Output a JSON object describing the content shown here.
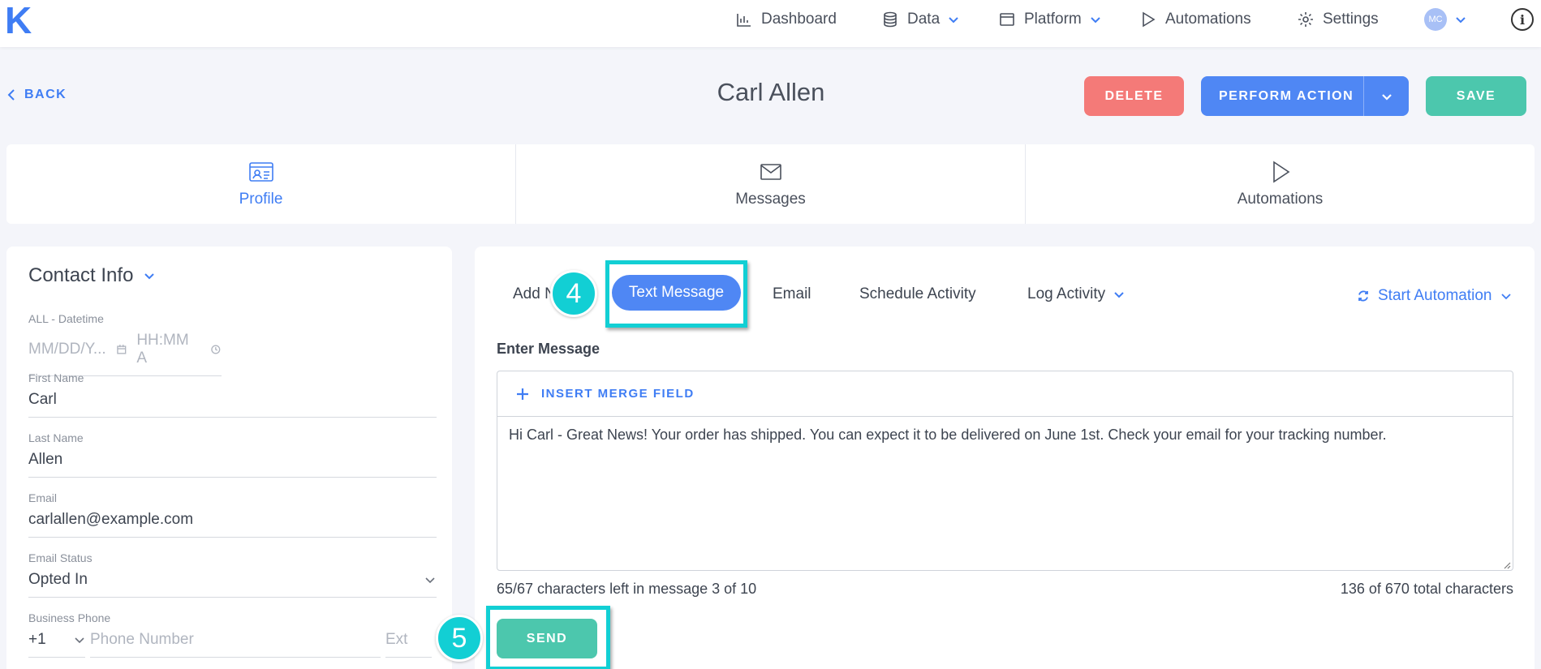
{
  "app": {
    "logo": "K"
  },
  "nav": {
    "dashboard": "Dashboard",
    "data": "Data",
    "platform": "Platform",
    "automations": "Automations",
    "settings": "Settings",
    "avatar_initials": "MC",
    "info": "i"
  },
  "header": {
    "back": "BACK",
    "title": "Carl Allen",
    "delete": "DELETE",
    "perform_action": "PERFORM ACTION",
    "save": "SAVE"
  },
  "tabs": [
    {
      "label": "Profile",
      "icon": "id-card-icon",
      "active": true
    },
    {
      "label": "Messages",
      "icon": "envelope-icon"
    },
    {
      "label": "Automations",
      "icon": "play-icon"
    }
  ],
  "contact": {
    "title": "Contact Info",
    "datetime": {
      "label": "ALL - Datetime",
      "date_placeholder": "MM/DD/Y...",
      "time_placeholder": "HH:MM A"
    },
    "first_name": {
      "label": "First Name",
      "value": "Carl"
    },
    "last_name": {
      "label": "Last Name",
      "value": "Allen"
    },
    "email": {
      "label": "Email",
      "value": "carlallen@example.com"
    },
    "email_status": {
      "label": "Email Status",
      "value": "Opted In"
    },
    "business_phone": {
      "label": "Business Phone",
      "country_code": "+1",
      "placeholder": "Phone Number",
      "ext_placeholder": "Ext"
    }
  },
  "messages": {
    "sub_tabs": {
      "add_note": "Add N",
      "text_message": "Text Message",
      "email": "Email",
      "schedule_activity": "Schedule Activity",
      "log_activity": "Log Activity"
    },
    "start_automation": "Start Automation",
    "enter_label": "Enter Message",
    "insert_merge": "INSERT MERGE FIELD",
    "message_text": "Hi Carl - Great News! Your order has shipped. You can expect it to be delivered on June 1st. Check your email for your tracking number.",
    "chars_left": "65/67 characters left in message 3 of 10",
    "total_chars": "136 of 670 total characters",
    "send": "SEND"
  },
  "annotations": {
    "step4": "4",
    "step5": "5",
    "highlight_color": "#12cfd4"
  },
  "colors": {
    "accent": "#3f7df4",
    "delete": "#f47a78",
    "save": "#4cc7ad"
  }
}
